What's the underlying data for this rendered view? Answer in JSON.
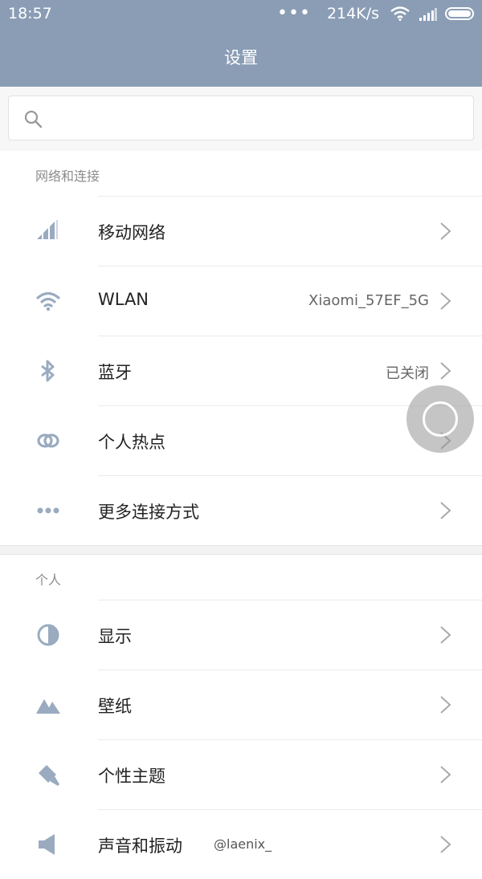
{
  "status_bar": {
    "time": "18:57",
    "dots": "•••",
    "speed": "214K/s"
  },
  "header": {
    "title": "设置"
  },
  "search": {
    "placeholder": ""
  },
  "sections": [
    {
      "title": "网络和连接",
      "items": [
        {
          "label": "移动网络",
          "value": "",
          "icon": "signal-icon"
        },
        {
          "label": "WLAN",
          "value": "Xiaomi_57EF_5G",
          "icon": "wifi-icon"
        },
        {
          "label": "蓝牙",
          "value": "已关闭",
          "icon": "bluetooth-icon"
        },
        {
          "label": "个人热点",
          "value": "",
          "icon": "hotspot-icon"
        },
        {
          "label": "更多连接方式",
          "value": "",
          "icon": "more-icon"
        }
      ]
    },
    {
      "title": "个人",
      "items": [
        {
          "label": "显示",
          "value": "",
          "icon": "display-icon"
        },
        {
          "label": "壁纸",
          "value": "",
          "icon": "wallpaper-icon"
        },
        {
          "label": "个性主题",
          "value": "",
          "icon": "theme-icon"
        },
        {
          "label": "声音和振动",
          "value": "",
          "icon": "speaker-icon"
        }
      ]
    }
  ],
  "watermark": "@laenix_",
  "colors": {
    "header_bg": "#8a9db5",
    "icon": "#9aabc0"
  }
}
